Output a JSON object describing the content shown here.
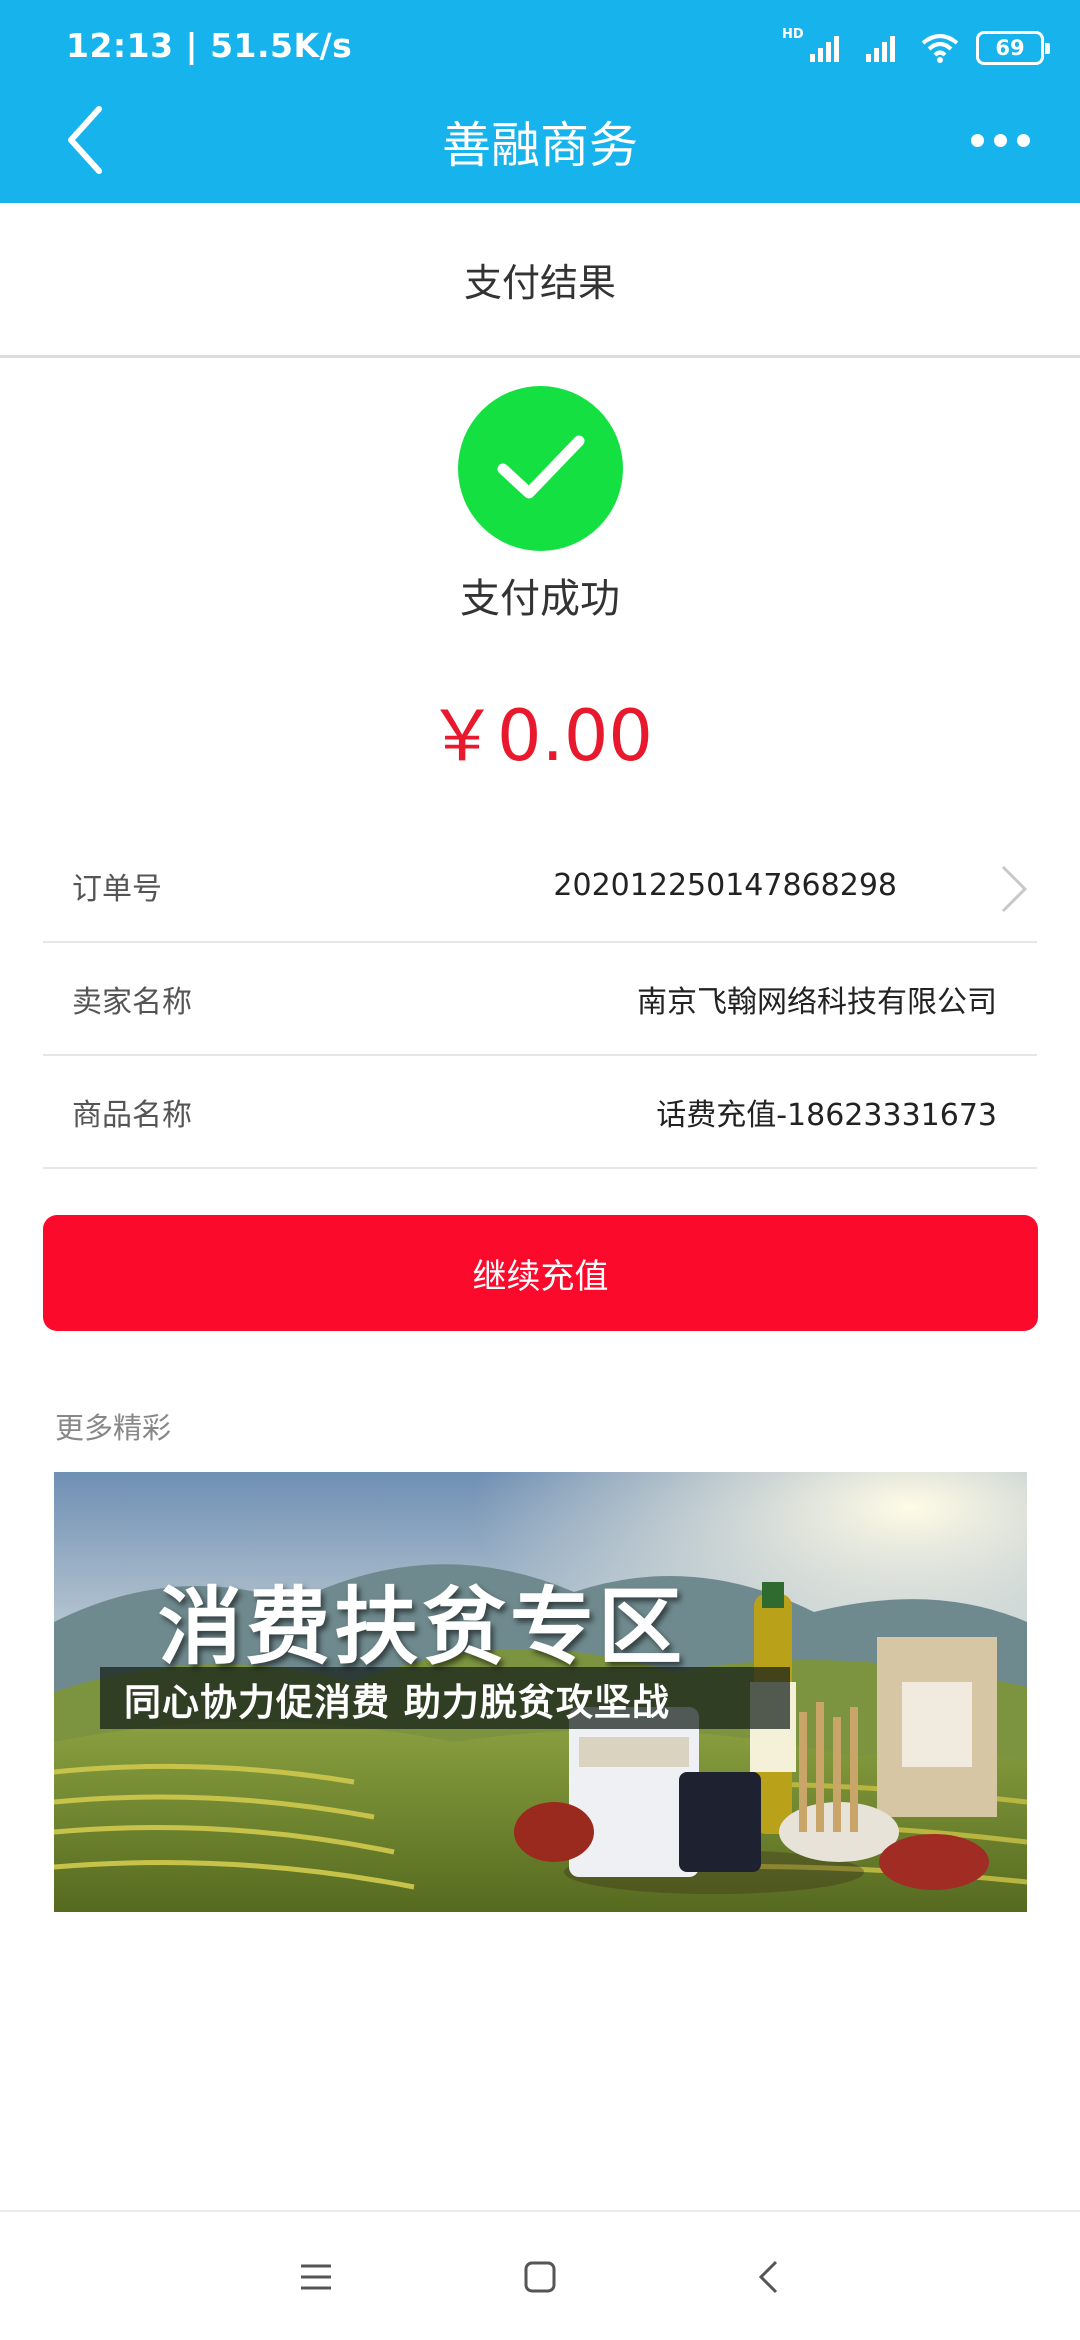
{
  "status_bar": {
    "time": "12:13 | 51.5K/s",
    "hd_label": "HD",
    "battery": "69"
  },
  "header": {
    "title": "善融商务"
  },
  "subheader": {
    "title": "支付结果"
  },
  "result": {
    "status": "支付成功",
    "amount": "￥0.00"
  },
  "details": [
    {
      "label": "订单号",
      "value": "202012250147868298"
    },
    {
      "label": "卖家名称",
      "value": "南京飞翰网络科技有限公司"
    },
    {
      "label": "商品名称",
      "value": "话费充值-18623331673"
    }
  ],
  "primary_button": {
    "label": "继续充值"
  },
  "more_section": {
    "label": "更多精彩"
  },
  "banner": {
    "title": "消费扶贫专区",
    "subtitle": "同心协力促消费 助力脱贫攻坚战"
  },
  "colors": {
    "header_bg": "#17B3EC",
    "success_green": "#14E041",
    "amount_red": "#E8192D",
    "button_red": "#FC0A2B"
  }
}
